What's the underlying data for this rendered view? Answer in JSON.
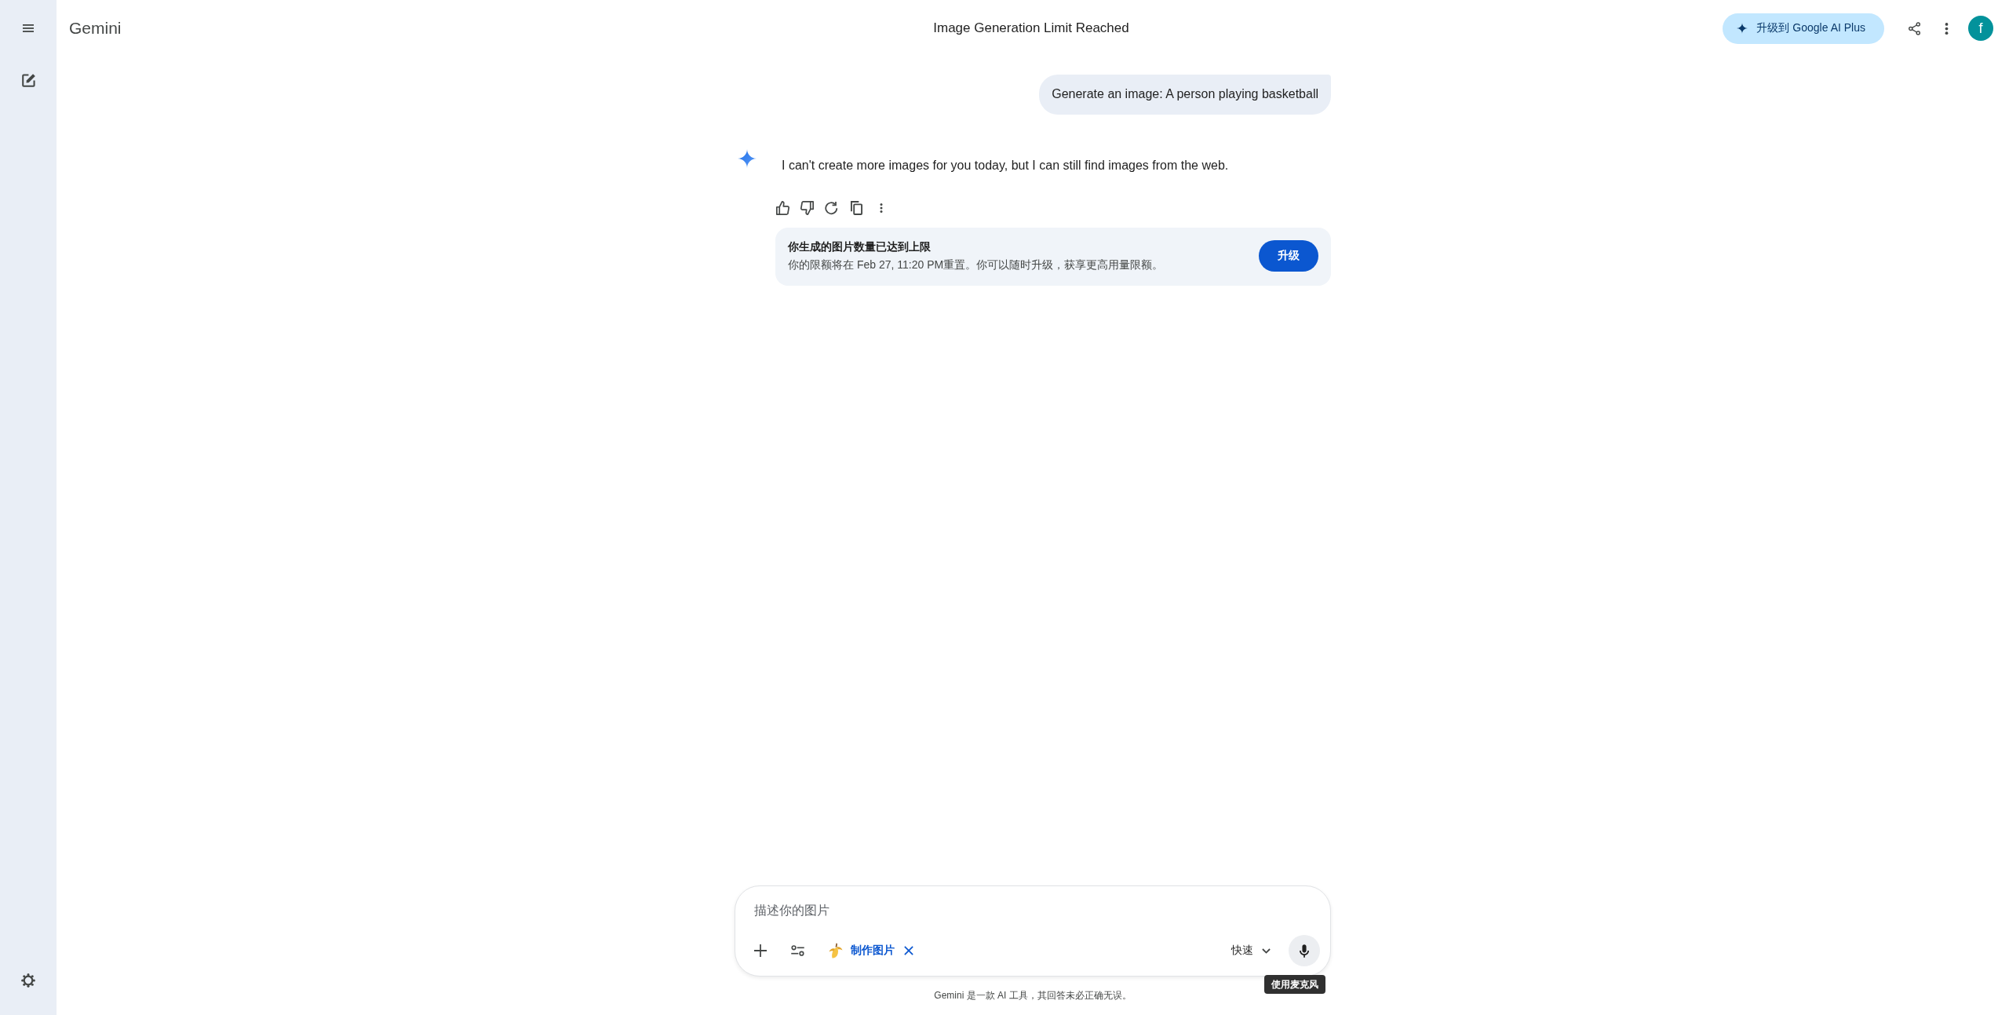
{
  "header": {
    "app_name": "Gemini",
    "title": "Image Generation Limit Reached",
    "upgrade_button": "升级到 Google AI Plus",
    "avatar_letter": "f"
  },
  "conversation": [
    {
      "kind": "user",
      "text": "Generate an image: A person playing basketball"
    },
    {
      "kind": "response",
      "text": "I can't create more images for you today, but I can still find images from the web.",
      "notice": {
        "title": "你生成的图片数量已达到上限",
        "body": "你的限额将在 Feb 27, 11:20 PM重置。你可以随时升级，获享更高用量限额。",
        "button": "升级"
      }
    }
  ],
  "composer": {
    "placeholder": "描述你的图片",
    "tool": "制作图片",
    "mode": "快速",
    "tooltip": "使用麦克风"
  },
  "disclaimer": "Gemini 是一款 AI 工具，其回答未必正确无误。"
}
